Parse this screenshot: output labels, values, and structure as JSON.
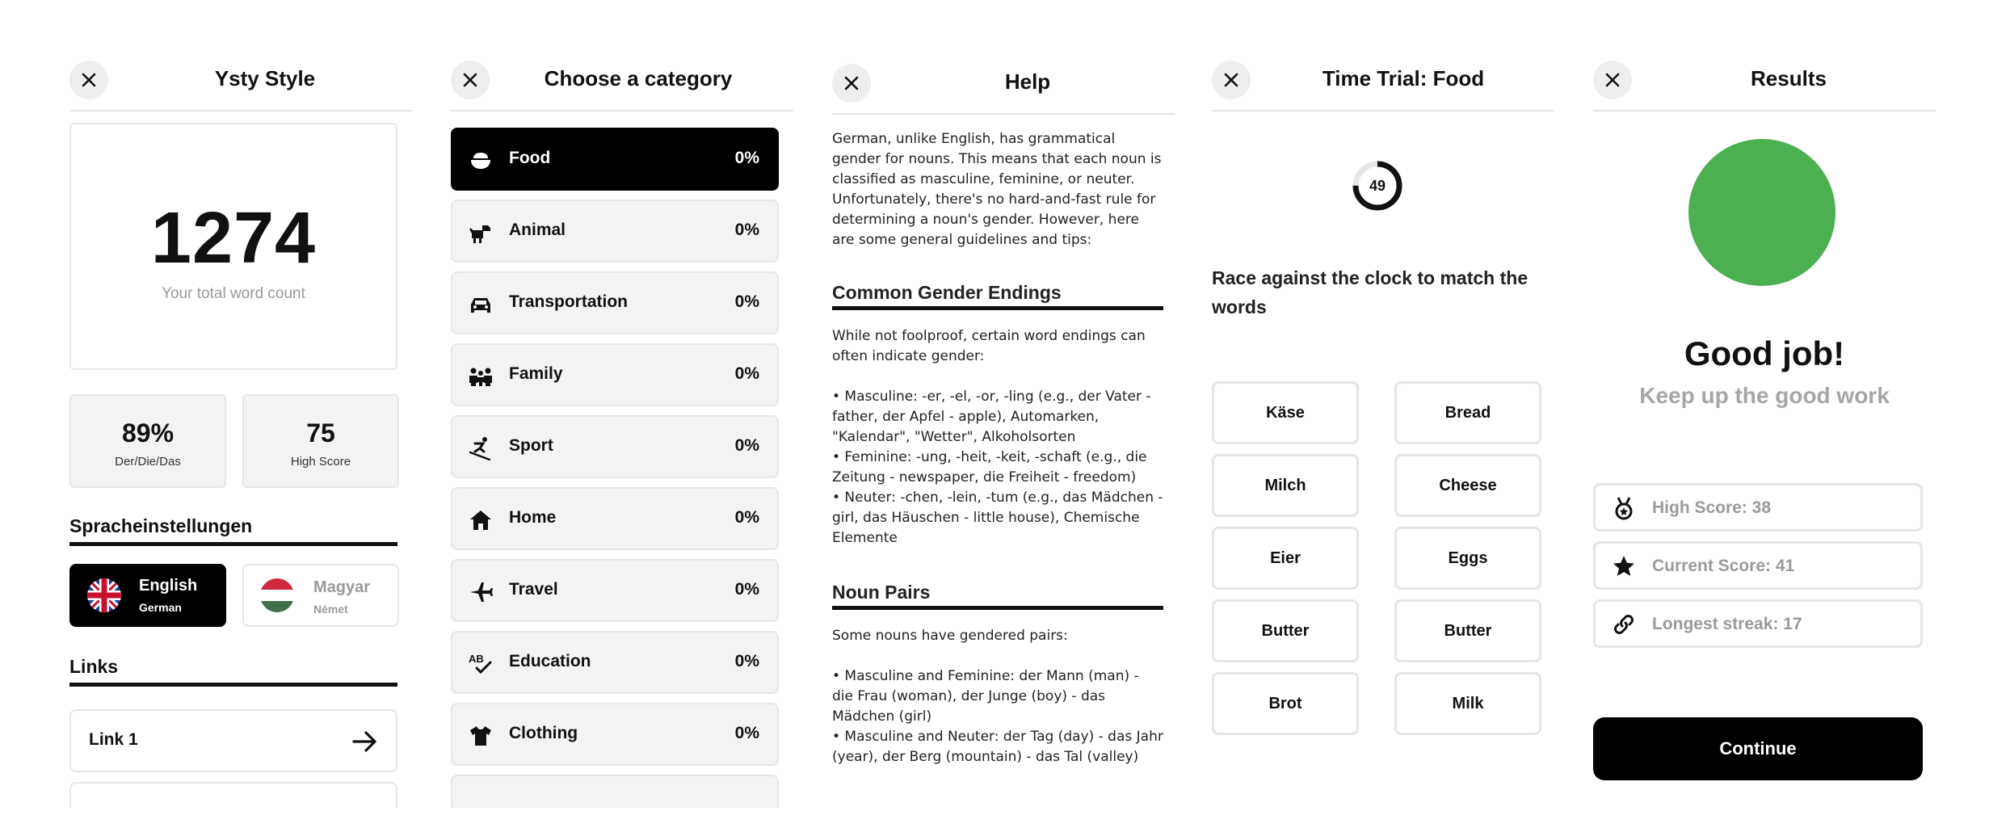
{
  "home": {
    "title": "Ysty Style",
    "word_count": "1274",
    "word_count_label": "Your total word count",
    "stats": [
      {
        "value": "89%",
        "label": "Der/Die/Das"
      },
      {
        "value": "75",
        "label": "High Score"
      }
    ],
    "language_section": "Spracheinstellungen",
    "languages": [
      {
        "name": "English",
        "sub": "German",
        "active": true
      },
      {
        "name": "Magyar",
        "sub": "Német",
        "active": false
      }
    ],
    "links_section": "Links",
    "links": [
      {
        "label": "Link 1"
      }
    ]
  },
  "categories": {
    "title": "Choose a category",
    "items": [
      {
        "label": "Food",
        "percent": "0%",
        "icon": "food-bowl-icon",
        "selected": true
      },
      {
        "label": "Animal",
        "percent": "0%",
        "icon": "dog-icon",
        "selected": false
      },
      {
        "label": "Transportation",
        "percent": "0%",
        "icon": "car-icon",
        "selected": false
      },
      {
        "label": "Family",
        "percent": "0%",
        "icon": "family-icon",
        "selected": false
      },
      {
        "label": "Sport",
        "percent": "0%",
        "icon": "skiing-icon",
        "selected": false
      },
      {
        "label": "Home",
        "percent": "0%",
        "icon": "house-icon",
        "selected": false
      },
      {
        "label": "Travel",
        "percent": "0%",
        "icon": "airplane-icon",
        "selected": false
      },
      {
        "label": "Education",
        "percent": "0%",
        "icon": "spellcheck-icon",
        "selected": false
      },
      {
        "label": "Clothing",
        "percent": "0%",
        "icon": "tshirt-icon",
        "selected": false
      }
    ]
  },
  "help": {
    "title": "Help",
    "intro": "German, unlike English, has grammatical gender for nouns. This means that each noun is classified as masculine, feminine, or neuter. Unfortunately, there's no hard-and-fast rule for determining a noun's gender. However, here are some general guidelines and tips:",
    "sections": [
      {
        "heading": "Common Gender Endings",
        "intro": "While not foolproof, certain word endings can often indicate gender:",
        "bullets": [
          "• Masculine: -er, -el, -or, -ling (e.g., der Vater - father, der Apfel - apple), Automarken, \"Kalendar\", \"Wetter\", Alkoholsorten",
          "• Feminine: -ung, -heit, -keit, -schaft (e.g., die Zeitung - newspaper, die Freiheit - freedom)",
          "• Neuter: -chen, -lein, -tum (e.g., das Mädchen - girl, das Häuschen - little house), Chemische Elemente"
        ]
      },
      {
        "heading": "Noun Pairs",
        "intro": "Some nouns have gendered pairs:",
        "bullets": [
          "• Masculine and Feminine: der Mann (man) - die Frau (woman), der Junge (boy) - das Mädchen (girl)",
          "• Masculine and Neuter: der Tag (day) - das Jahr (year), der Berg (mountain) - das Tal (valley)"
        ]
      }
    ]
  },
  "trial": {
    "title": "Time Trial: Food",
    "timer": "49",
    "timer_progress": 0.75,
    "instruction": "Race against the clock to match the words",
    "left_words": [
      "Käse",
      "Milch",
      "Eier",
      "Butter",
      "Brot"
    ],
    "right_words": [
      "Bread",
      "Cheese",
      "Eggs",
      "Butter",
      "Milk"
    ]
  },
  "results": {
    "title": "Results",
    "headline": "Good job!",
    "subline": "Keep up the good work",
    "scores": [
      {
        "label": "High Score: 38",
        "icon": "medal-icon"
      },
      {
        "label": "Current Score: 41",
        "icon": "star-icon"
      },
      {
        "label": "Longest streak: 17",
        "icon": "link-chain-icon"
      }
    ],
    "continue_label": "Continue",
    "accent": "#4caf50"
  }
}
